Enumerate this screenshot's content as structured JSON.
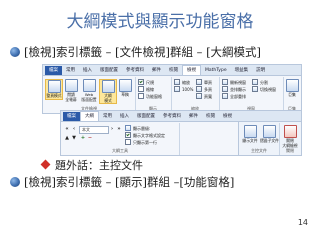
{
  "slide": {
    "title": "大綱模式與顯示功能窗格",
    "bullet1": "[檢視]索引標籤 – [文件檢視]群組 – [大綱模式]",
    "sub_bullet": "題外話：主控文件",
    "bullet2": "[檢視]索引標籤 – [顯示]群組 –[功能窗格]",
    "page_number": "14"
  },
  "ribbon1": {
    "tabs": [
      {
        "label": "檔案",
        "state": "file"
      },
      {
        "label": "常用",
        "state": ""
      },
      {
        "label": "插入",
        "state": ""
      },
      {
        "label": "版面配置",
        "state": ""
      },
      {
        "label": "參考資料",
        "state": ""
      },
      {
        "label": "郵件",
        "state": ""
      },
      {
        "label": "校閱",
        "state": ""
      },
      {
        "label": "檢視",
        "state": "active"
      },
      {
        "label": "MathType",
        "state": ""
      },
      {
        "label": "增益集",
        "state": ""
      },
      {
        "label": "説明",
        "state": ""
      }
    ],
    "views": [
      {
        "label": "整頁模式",
        "highlight": true
      },
      {
        "label": "閱讀\n全螢幕",
        "highlight": false
      },
      {
        "label": "Web\n版面配置",
        "highlight": false
      },
      {
        "label": "大綱\n模式",
        "highlight": true
      },
      {
        "label": "草稿",
        "highlight": false
      }
    ],
    "group_doc_views": "文件檢視",
    "show_items": [
      {
        "label": "尺規",
        "checked": true
      },
      {
        "label": "格線",
        "checked": false
      },
      {
        "label": "功能窗格",
        "checked": false
      }
    ],
    "group_show": "顯示",
    "zoom_items": [
      "縮放",
      "100%",
      "單頁",
      "多頁",
      "頁寬"
    ],
    "group_zoom": "縮放",
    "window_items": [
      "開新視窗",
      "並排顯示",
      "全部重排",
      "分割",
      "切換視窗"
    ],
    "group_window": "視窗",
    "macro_label": "巨集",
    "group_macro": "巨集"
  },
  "ribbon2": {
    "tabs": [
      {
        "label": "檔案",
        "state": "file"
      },
      {
        "label": "大綱",
        "state": "active"
      },
      {
        "label": "常用",
        "state": ""
      },
      {
        "label": "插入",
        "state": ""
      },
      {
        "label": "版面配置",
        "state": ""
      },
      {
        "label": "參考資料",
        "state": ""
      },
      {
        "label": "郵件",
        "state": ""
      },
      {
        "label": "校閱",
        "state": ""
      },
      {
        "label": "檢視",
        "state": ""
      }
    ],
    "level_value": "本文",
    "show_level_label": "顯示層級:",
    "show_text_format": "顯示文字格式設定",
    "first_line_only": "只顯示第一行",
    "group_outline_tools": "大綱工具",
    "show_document": "顯示文件",
    "collapse_subdocs": "摺疊子文件",
    "group_master": "主控文件",
    "close_outline": "關閉\n大綱檢視",
    "group_close": "關閉"
  }
}
